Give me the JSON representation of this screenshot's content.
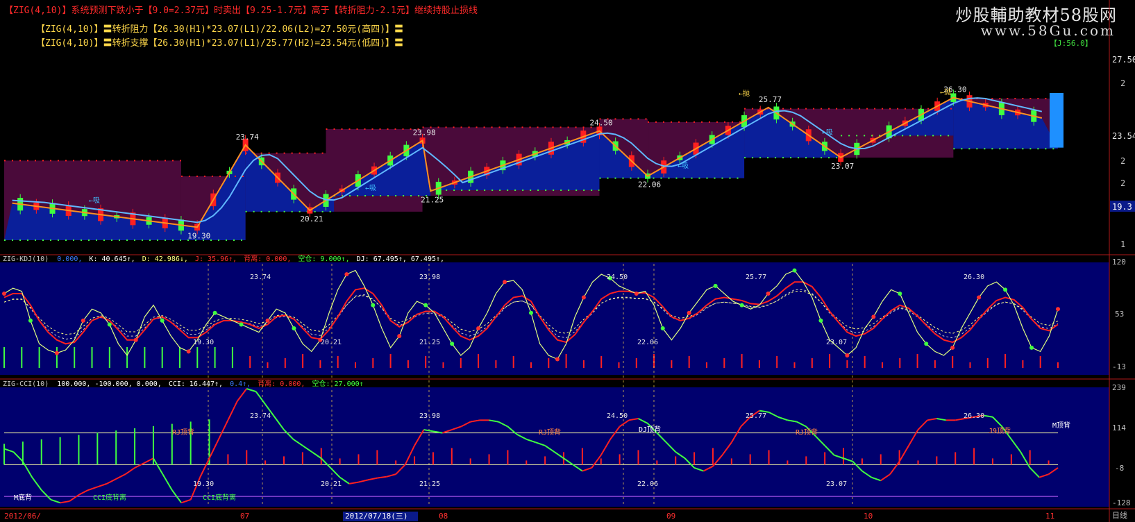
{
  "header": {
    "top_line": "【ZIG(4,10)】系统预测下跌小于【9.0=2.37元】时卖出【9.25-1.7元】高于【转折阻力-2.1元】继续持股止损线",
    "resist_line": "【ZIG(4,10)】〓转折阻力【26.30(H1)*23.07(L1)/22.06(L2)=27.50元(高四)】〓",
    "support_line": "【ZIG(4,10)】〓转折支撑【26.30(H1)*23.07(L1)/25.77(H2)=23.54元(低四)】〓",
    "watermark_title": "炒股輔助教材58股网",
    "watermark_url": "www.58Gu.com",
    "corner_tag": "【J:56.0】"
  },
  "right_axis": {
    "price_top": "27.50元",
    "price_2a": "2",
    "price_support": "23.54元",
    "price_2b": "2",
    "price_2c": "2",
    "price_current": "19.3",
    "price_1": "1",
    "kdj_top": "120",
    "kdj_mid": "53",
    "kdj_low": "-13",
    "cci_top": "239",
    "cci_mid": "114",
    "cci_low": "-8",
    "cci_bottom": "-128",
    "period_label": "日线"
  },
  "kdj_header": {
    "name": "ZIG-KDJ(10)",
    "v0": "0.000,",
    "k": "K: 40.645↑,",
    "d": "D: 42.986↓,",
    "j": "J: 35.96↑,",
    "beitan": "背离: 0.000,",
    "kongcang": "空仓: 9.000↑,",
    "dj": "DJ: 67.495↑, 67.495↑,"
  },
  "cci_header": {
    "name": "ZIG-CCI(10)",
    "levels": "100.000, -100.000, 0.000,",
    "cci": "CCI: 16.447↑,",
    "v2": "0.4↑,",
    "beili": "背离: 0.000,",
    "kongcang": "空仓: 27.000↑"
  },
  "date_axis": {
    "d0": "2012/06/",
    "d1": "07",
    "d2": "2012/07/18(三)",
    "d3": "08",
    "d4": "09",
    "d5": "10",
    "d6": "11"
  },
  "annotations": {
    "cci_m_bottom": "M底背",
    "cci_bottom_div1": "CCI底背离",
    "cci_bottom_div2": "CCI底背离",
    "cci_rj1": "RJ顶背",
    "cci_rj2": "RJ顶背",
    "cci_dj": "DJ顶背",
    "cci_rj3": "RJ顶背",
    "cci_j9": "J9顶背",
    "cci_mtop": "M顶背",
    "arrow_buy": "←吸",
    "arrow_sell": "←抛"
  },
  "chart_data": [
    {
      "type": "candlestick",
      "title": "ZIG(4,10) 转折阻力/支撑",
      "zig_turning_points": [
        {
          "x": 1,
          "y": 20.6
        },
        {
          "x": 24,
          "y": 19.3
        },
        {
          "x": 30,
          "y": 23.74
        },
        {
          "x": 38,
          "y": 20.21
        },
        {
          "x": 52,
          "y": 23.98
        },
        {
          "x": 53,
          "y": 21.25
        },
        {
          "x": 74,
          "y": 24.5
        },
        {
          "x": 80,
          "y": 22.06
        },
        {
          "x": 95,
          "y": 25.77
        },
        {
          "x": 104,
          "y": 23.07
        },
        {
          "x": 118,
          "y": 26.3
        },
        {
          "x": 129,
          "y": 25.2
        }
      ],
      "pivot_labels": [
        "19.30",
        "23.74",
        "20.21",
        "23.98",
        "21.25",
        "24.50",
        "22.06",
        "25.77",
        "23.07",
        "26.30"
      ],
      "resistance": [
        {
          "x0": 0,
          "x1": 22,
          "y": 22.9
        },
        {
          "x0": 22,
          "x1": 30,
          "y": 22.05
        },
        {
          "x0": 30,
          "x1": 40,
          "y": 23.3
        },
        {
          "x0": 40,
          "x1": 52,
          "y": 24.6
        },
        {
          "x0": 52,
          "x1": 74,
          "y": 24.7
        },
        {
          "x0": 74,
          "x1": 80,
          "y": 25.15
        },
        {
          "x0": 80,
          "x1": 92,
          "y": 24.98
        },
        {
          "x0": 92,
          "x1": 118,
          "y": 25.7
        },
        {
          "x0": 118,
          "x1": 131,
          "y": 26.25
        }
      ],
      "support": [
        {
          "x0": 0,
          "x1": 30,
          "y": 18.6
        },
        {
          "x0": 30,
          "x1": 41,
          "y": 20.14
        },
        {
          "x0": 41,
          "x1": 53,
          "y": 21.0
        },
        {
          "x0": 53,
          "x1": 74,
          "y": 21.3
        },
        {
          "x0": 74,
          "x1": 92,
          "y": 21.95
        },
        {
          "x0": 92,
          "x1": 104,
          "y": 23.06
        },
        {
          "x0": 104,
          "x1": 118,
          "y": 24.25
        },
        {
          "x0": 118,
          "x1": 131,
          "y": 23.54
        }
      ],
      "ylim": [
        18.0,
        28.8
      ],
      "xlim": [
        0,
        131
      ]
    },
    {
      "type": "line",
      "title": "ZIG-KDJ(10)",
      "ylim": [
        -13,
        120
      ],
      "pivot_labels": [
        "23.74",
        "23.98",
        "24.50",
        "25.77",
        "26.30",
        "19.30",
        "20.21",
        "21.25",
        "22.06",
        "23.07"
      ],
      "series": [
        {
          "name": "K",
          "values": [
            85,
            92,
            88,
            50,
            20,
            12,
            8,
            12,
            25,
            50,
            65,
            60,
            45,
            20,
            5,
            25,
            55,
            70,
            50,
            30,
            15,
            10,
            25,
            45,
            60,
            55,
            50,
            45,
            40,
            35,
            50,
            65,
            60,
            40,
            20,
            10,
            25,
            60,
            90,
            110,
            115,
            95,
            70,
            40,
            15,
            30,
            60,
            75,
            70,
            60,
            40,
            20,
            5,
            15,
            40,
            60,
            85,
            100,
            102,
            90,
            60,
            20,
            5,
            0,
            20,
            55,
            80,
            100,
            110,
            105,
            95,
            90,
            85,
            88,
            70,
            40,
            25,
            40,
            60,
            75,
            90,
            95,
            85,
            75,
            70,
            65,
            70,
            85,
            95,
            110,
            115,
            100,
            80,
            50,
            25,
            15,
            5,
            15,
            40,
            55,
            75,
            90,
            85,
            60,
            35,
            20,
            10,
            5,
            15,
            40,
            60,
            80,
            95,
            100,
            90,
            70,
            40,
            15,
            10,
            30,
            65
          ]
        },
        {
          "name": "D",
          "values": [
            80,
            85,
            85,
            70,
            50,
            35,
            25,
            20,
            22,
            35,
            50,
            55,
            50,
            38,
            25,
            25,
            38,
            52,
            55,
            48,
            38,
            28,
            28,
            35,
            45,
            50,
            50,
            48,
            45,
            40,
            45,
            55,
            57,
            52,
            40,
            28,
            26,
            38,
            55,
            75,
            90,
            92,
            85,
            70,
            50,
            42,
            48,
            58,
            62,
            62,
            55,
            42,
            30,
            25,
            30,
            40,
            55,
            70,
            80,
            82,
            75,
            55,
            38,
            25,
            22,
            32,
            48,
            62,
            78,
            85,
            88,
            88,
            86,
            86,
            80,
            68,
            55,
            50,
            53,
            60,
            70,
            78,
            80,
            78,
            76,
            72,
            71,
            75,
            82,
            92,
            100,
            100,
            94,
            80,
            62,
            48,
            35,
            30,
            33,
            40,
            52,
            63,
            70,
            66,
            56,
            44,
            33,
            25,
            22,
            28,
            38,
            52,
            65,
            76,
            80,
            77,
            67,
            52,
            40,
            37,
            45
          ]
        }
      ]
    },
    {
      "type": "line",
      "title": "ZIG-CCI(10)",
      "ylim": [
        -128,
        239
      ],
      "pivot_labels": [
        "23.74",
        "23.98",
        "24.50",
        "25.77",
        "26.30",
        "19.30",
        "20.21",
        "21.25",
        "22.06",
        "23.07"
      ],
      "series": [
        {
          "name": "CCI",
          "values": [
            50,
            40,
            10,
            -40,
            -80,
            -110,
            -120,
            -115,
            -95,
            -80,
            -70,
            -60,
            -45,
            -30,
            -10,
            5,
            20,
            -30,
            -80,
            -120,
            -110,
            -40,
            20,
            80,
            140,
            200,
            239,
            230,
            190,
            150,
            110,
            80,
            60,
            40,
            20,
            -10,
            -40,
            -60,
            -55,
            -48,
            -42,
            -38,
            -30,
            0,
            60,
            110,
            105,
            100,
            110,
            120,
            135,
            140,
            140,
            135,
            120,
            95,
            80,
            70,
            60,
            40,
            20,
            0,
            -20,
            -10,
            30,
            80,
            120,
            140,
            145,
            130,
            100,
            70,
            40,
            20,
            -10,
            -20,
            -5,
            30,
            70,
            120,
            150,
            170,
            165,
            150,
            140,
            135,
            120,
            90,
            60,
            30,
            20,
            10,
            -20,
            -40,
            -50,
            -30,
            10,
            60,
            110,
            140,
            145,
            140,
            140,
            145,
            150,
            155,
            150,
            120,
            80,
            40,
            -10,
            -40,
            -30,
            -10
          ]
        }
      ]
    }
  ]
}
